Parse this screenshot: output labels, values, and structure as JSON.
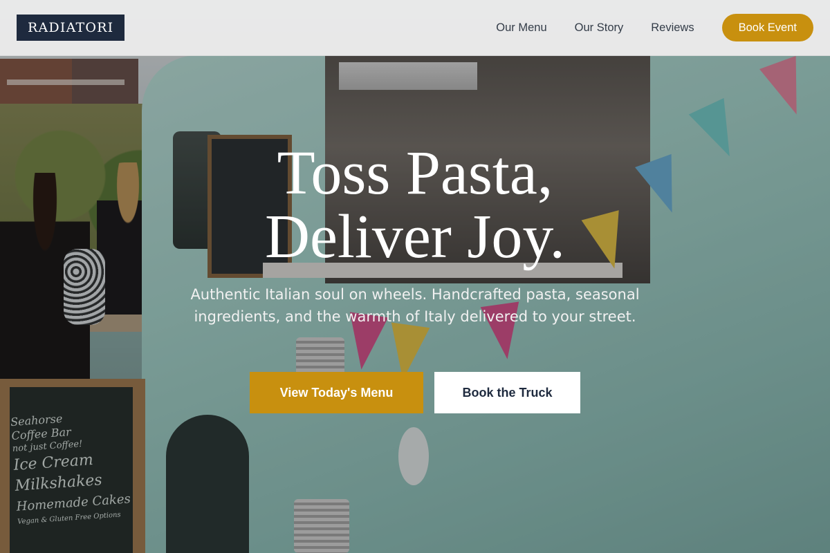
{
  "brand": {
    "logo_text": "RADIATORI"
  },
  "nav": {
    "items": [
      {
        "label": "Our Menu"
      },
      {
        "label": "Our Story"
      },
      {
        "label": "Reviews"
      }
    ],
    "cta_label": "Book Event"
  },
  "hero": {
    "title_line1": "Toss Pasta,",
    "title_line2": "Deliver Joy.",
    "subtitle": "Authentic Italian soul on wheels. Handcrafted pasta, seasonal ingredients, and the warmth of Italy delivered to your street.",
    "primary_button": "View Today's Menu",
    "secondary_button": "Book the Truck",
    "background_image": {
      "chalkboard_text": [
        "Seahorse",
        "Coffee Bar",
        "not just Coffee!",
        "Ice Cream",
        "Milkshakes",
        "Homemade Cakes",
        "Vegan & Gluten Free Options"
      ]
    }
  },
  "colors": {
    "brand_navy": "#1e2a3e",
    "accent_gold": "#c8900f",
    "header_bg": "#f0f0f0",
    "text_light": "#ffffff"
  }
}
